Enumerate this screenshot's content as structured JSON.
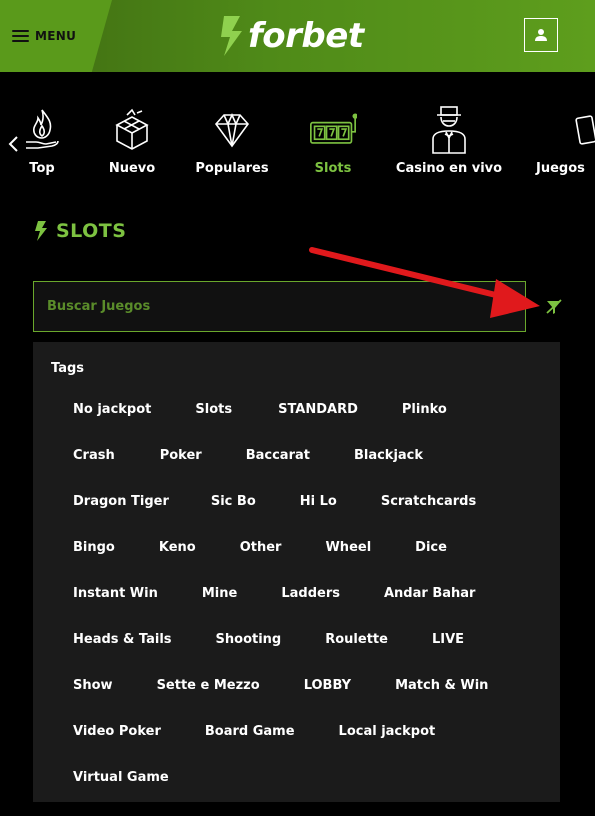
{
  "header": {
    "menu_label": "MENU",
    "logo_text": "forbet"
  },
  "categories": [
    {
      "label": "Top",
      "icon": "flame-hand-icon"
    },
    {
      "label": "Nuevo",
      "icon": "gift-box-icon"
    },
    {
      "label": "Populares",
      "icon": "diamond-icon"
    },
    {
      "label": "Slots",
      "icon": "slot-machine-icon",
      "active": true
    },
    {
      "label": "Casino en vivo",
      "icon": "dealer-icon"
    },
    {
      "label": "Juegos",
      "icon": "cards-icon"
    }
  ],
  "section": {
    "title": "SLOTS"
  },
  "search": {
    "placeholder": "Buscar Juegos"
  },
  "tags_panel": {
    "title": "Tags",
    "rows": [
      [
        "No jackpot",
        "Slots",
        "STANDARD",
        "Plinko"
      ],
      [
        "Crash",
        "Poker",
        "Baccarat",
        "Blackjack"
      ],
      [
        "Dragon Tiger",
        "Sic Bo",
        "Hi Lo",
        "Scratchcards"
      ],
      [
        "Bingo",
        "Keno",
        "Other",
        "Wheel",
        "Dice"
      ],
      [
        "Instant Win",
        "Mine",
        "Ladders",
        "Andar Bahar"
      ],
      [
        "Heads & Tails",
        "Shooting",
        "Roulette",
        "LIVE"
      ],
      [
        "Show",
        "Sette e Mezzo",
        "LOBBY",
        "Match & Win"
      ],
      [
        "Video Poker",
        "Board Game",
        "Local jackpot"
      ],
      [
        "Virtual Game"
      ]
    ]
  },
  "colors": {
    "accent_green": "#7dc241",
    "header_green": "#5a9a1b",
    "annotation_red": "#e0191c"
  }
}
